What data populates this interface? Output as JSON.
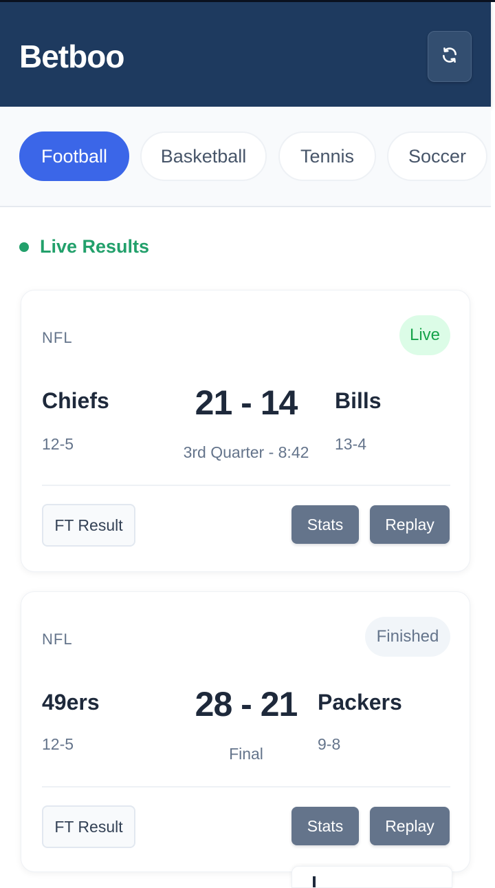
{
  "app": {
    "brand": "Betboo"
  },
  "colors": {
    "header_bg": "#1e3a5f",
    "accent": "#3b66e8",
    "live_green": "#22a06b",
    "button_gray": "#64748b"
  },
  "header": {
    "refresh_icon": "refresh-icon"
  },
  "tabs": [
    {
      "label": "Football",
      "active": true
    },
    {
      "label": "Basketball",
      "active": false
    },
    {
      "label": "Tennis",
      "active": false
    },
    {
      "label": "Soccer",
      "active": false
    }
  ],
  "section": {
    "title": "Live Results"
  },
  "matches": [
    {
      "league": "NFL",
      "status": "Live",
      "home": {
        "name": "Chiefs",
        "record": "12-5"
      },
      "away": {
        "name": "Bills",
        "record": "13-4"
      },
      "score": "21 - 14",
      "period": "3rd Quarter - 8:42",
      "ft_label": "FT Result",
      "stats_label": "Stats",
      "replay_label": "Replay"
    },
    {
      "league": "NFL",
      "status": "Finished",
      "home": {
        "name": "49ers",
        "record": "12-5"
      },
      "away": {
        "name": "Packers",
        "record": "9-8"
      },
      "score": "28 - 21",
      "period": "Final",
      "ft_label": "FT Result",
      "stats_label": "Stats",
      "replay_label": "Replay"
    }
  ]
}
